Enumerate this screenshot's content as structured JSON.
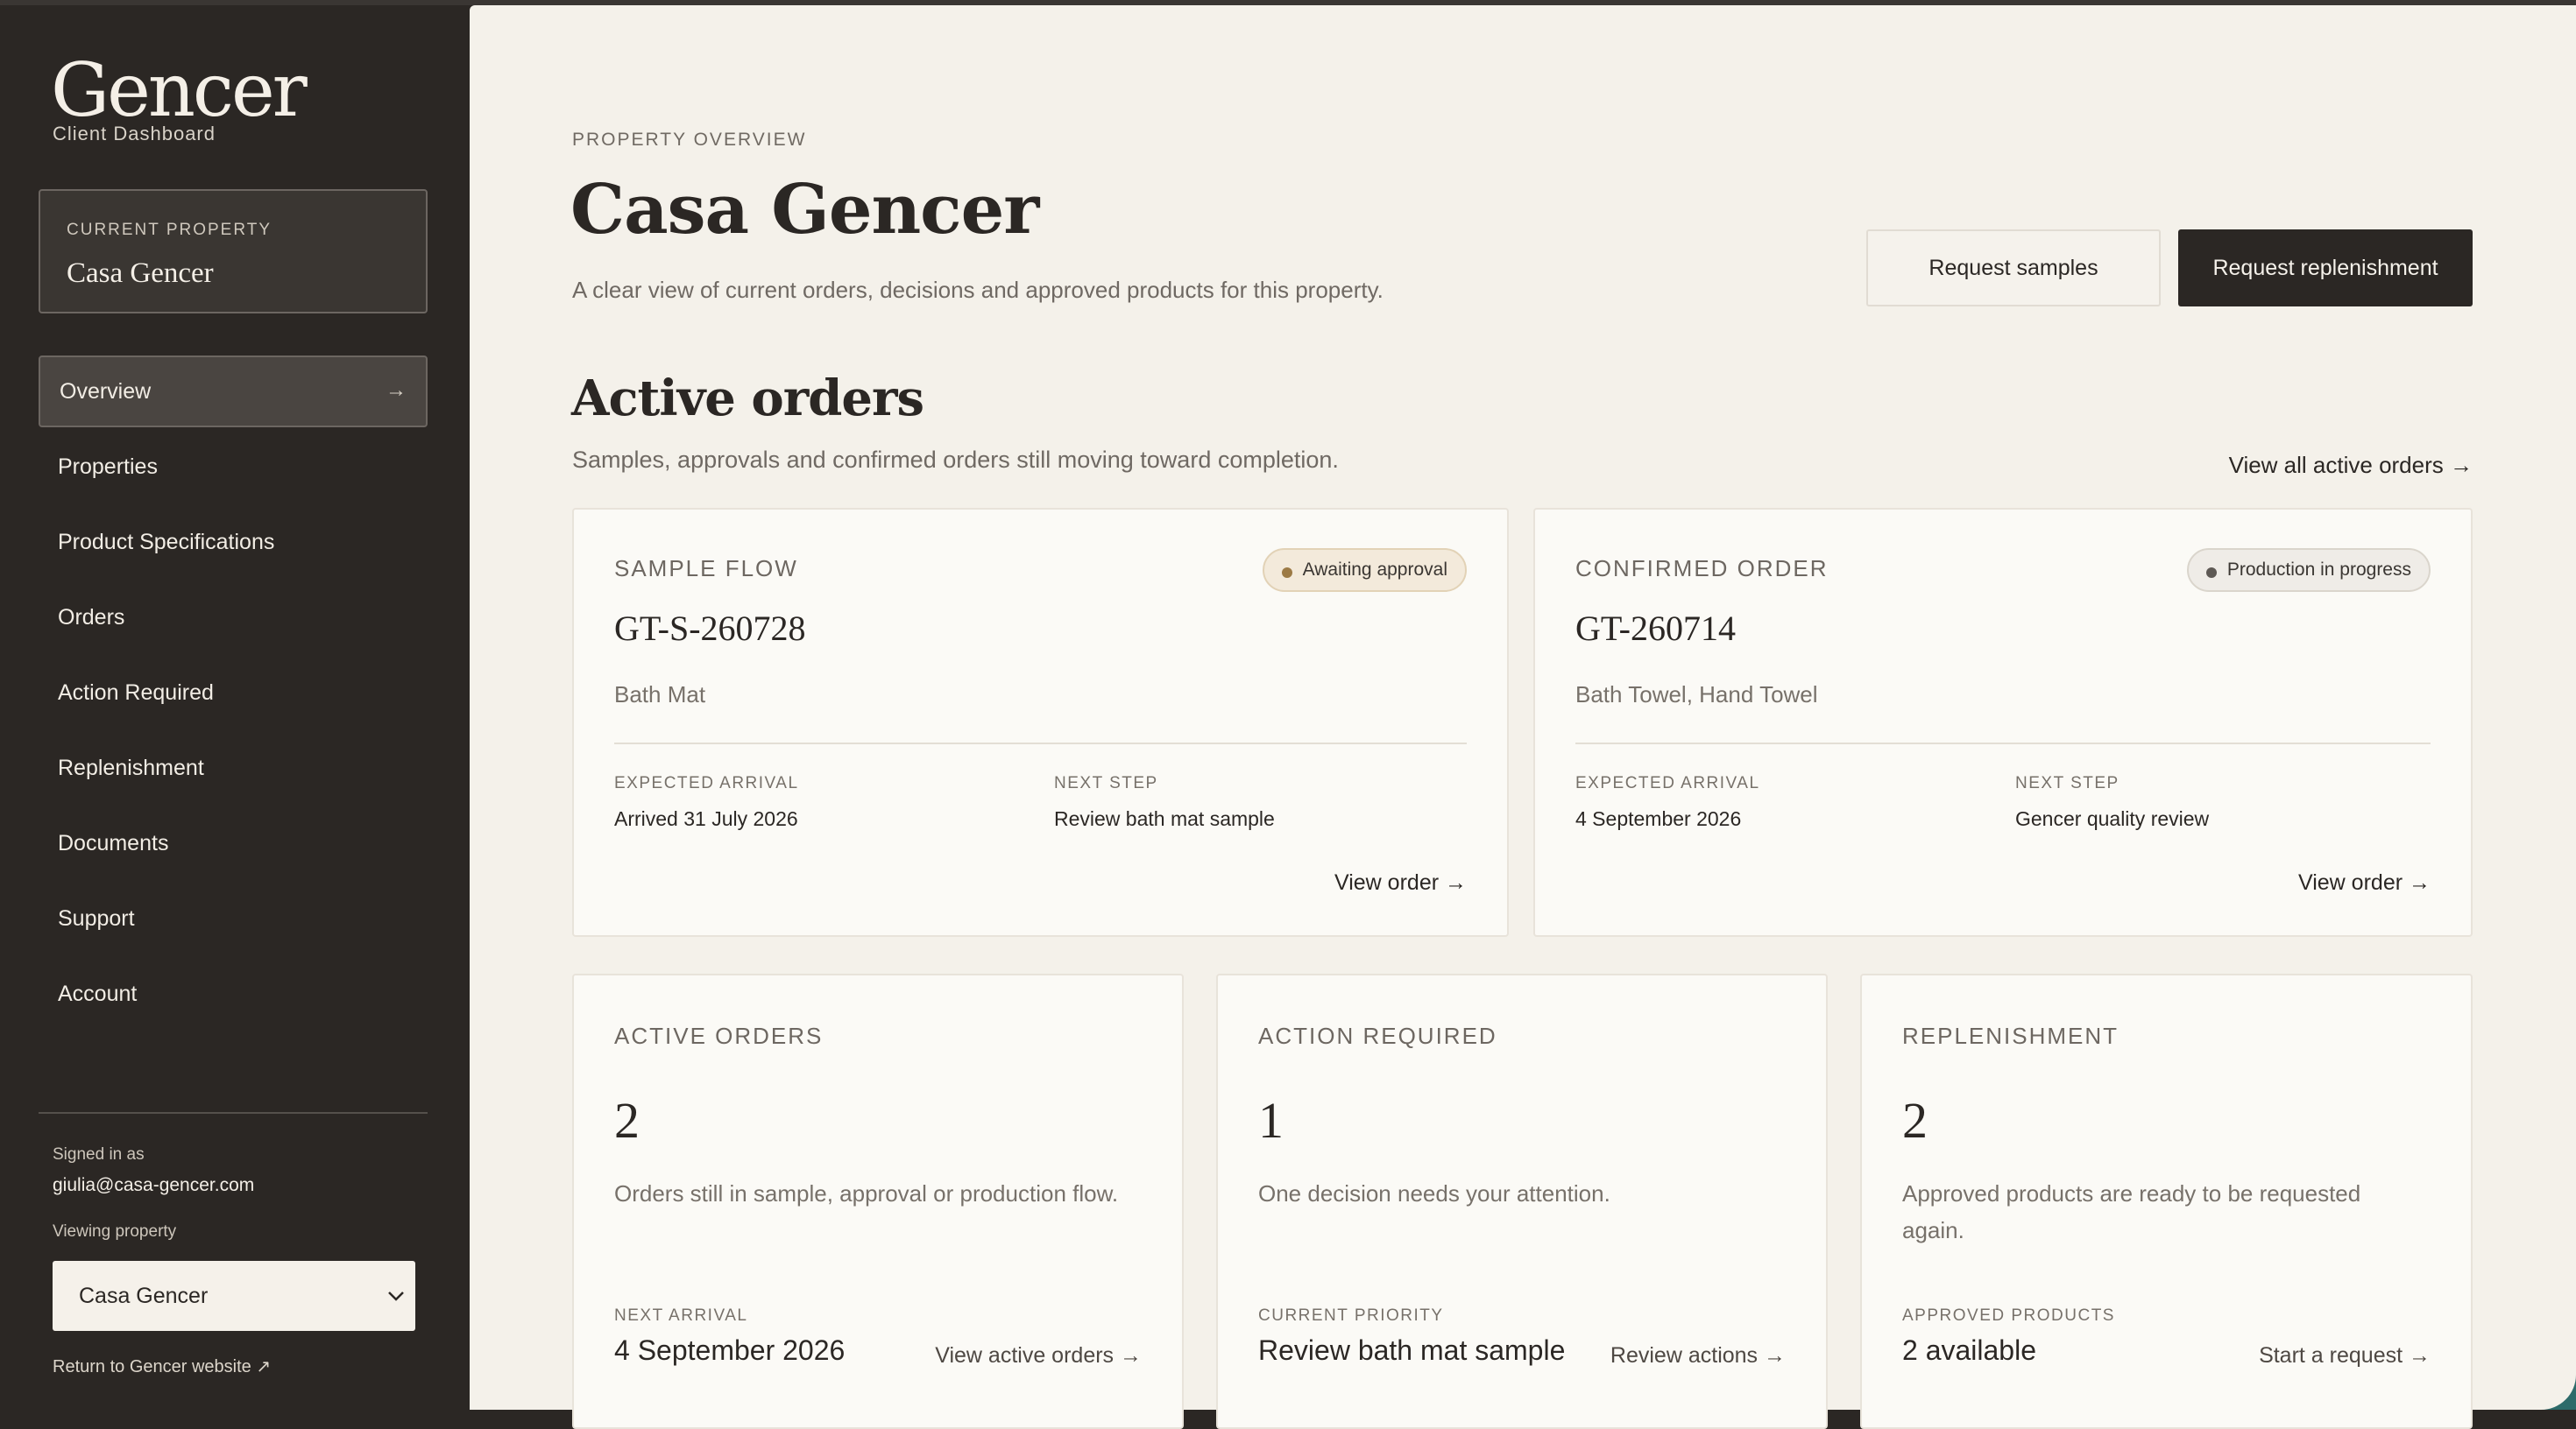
{
  "sidebar": {
    "brand": "Gencer",
    "brand_sub": "Client Dashboard",
    "current_property_label": "CURRENT PROPERTY",
    "current_property": "Casa Gencer",
    "nav": [
      {
        "label": "Overview",
        "active": true
      },
      {
        "label": "Properties"
      },
      {
        "label": "Product Specifications"
      },
      {
        "label": "Orders"
      },
      {
        "label": "Action Required"
      },
      {
        "label": "Replenishment"
      },
      {
        "label": "Documents"
      },
      {
        "label": "Support"
      },
      {
        "label": "Account"
      }
    ],
    "nav_arrow": "→",
    "signed_in_label": "Signed in as",
    "signed_in_email": "giulia@casa-gencer.com",
    "viewing_label": "Viewing property",
    "viewing_value": "Casa Gencer",
    "return_link": "Return to Gencer website ↗"
  },
  "header": {
    "eyebrow": "PROPERTY OVERVIEW",
    "title": "Casa Gencer",
    "subtitle": "A clear view of current orders, decisions and approved products for this property.",
    "btn_samples": "Request samples",
    "btn_replenishment": "Request replenishment"
  },
  "active_orders": {
    "title": "Active orders",
    "subtitle": "Samples, approvals and confirmed orders still moving toward completion.",
    "view_all": "View all active orders →",
    "cards": [
      {
        "kicker": "SAMPLE FLOW",
        "badge": "Awaiting approval",
        "order_no": "GT-S-260728",
        "product": "Bath Mat",
        "arrival_label": "EXPECTED ARRIVAL",
        "arrival_value": "Arrived 31 July 2026",
        "next_label": "NEXT STEP",
        "next_value": "Review bath mat sample",
        "link": "View order →"
      },
      {
        "kicker": "CONFIRMED ORDER",
        "badge": "Production in progress",
        "order_no": "GT-260714",
        "product": "Bath Towel, Hand Towel",
        "arrival_label": "EXPECTED ARRIVAL",
        "arrival_value": "4 September 2026",
        "next_label": "NEXT STEP",
        "next_value": "Gencer quality review",
        "link": "View order →"
      }
    ]
  },
  "stats": [
    {
      "kicker": "ACTIVE ORDERS",
      "num": "2",
      "desc": "Orders still in sample, approval or production flow.",
      "foot_label": "NEXT ARRIVAL",
      "foot_value": "4 September 2026",
      "link": "View active orders →"
    },
    {
      "kicker": "ACTION REQUIRED",
      "num": "1",
      "desc": "One decision needs your attention.",
      "foot_label": "CURRENT PRIORITY",
      "foot_value": "Review bath mat sample",
      "link": "Review actions →"
    },
    {
      "kicker": "REPLENISHMENT",
      "num": "2",
      "desc": "Approved products are ready to be requested again.",
      "foot_label": "APPROVED PRODUCTS",
      "foot_value": "2 available",
      "link": "Start a request →"
    }
  ],
  "colors": {
    "sidebar_bg": "#2b2724",
    "main_bg": "#f4f1ea",
    "card_bg": "#fbfaf6",
    "badge_amber": "#9c7a45"
  }
}
